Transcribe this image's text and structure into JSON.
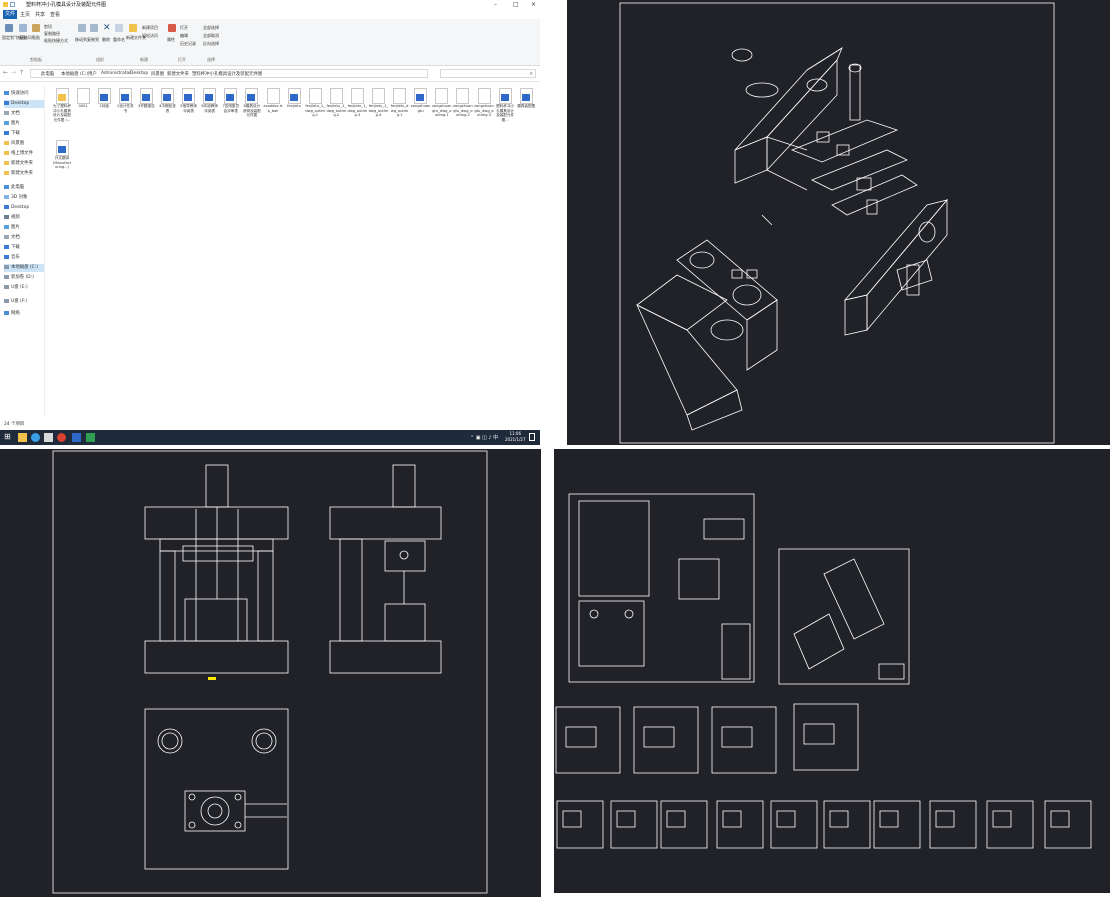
{
  "explorer": {
    "title": "塑料杯冲小孔模具设计及装配元件图",
    "tabs": [
      "文件",
      "主页",
      "共享",
      "查看"
    ],
    "active_tab": "文件",
    "ribbon": {
      "pin_label": "固定到\"快速访问\"",
      "copy_label": "复制",
      "paste_label": "粘贴",
      "copy_path": "复制路径",
      "paste_shortcut": "粘贴快捷方式",
      "cut": "剪切",
      "move_to": "移动到",
      "copy_to": "复制到",
      "delete": "删除",
      "rename": "重命名",
      "new_folder": "新建文件夹",
      "new_item": "新建项目",
      "easy_access": "轻松访问",
      "properties": "属性",
      "open": "打开",
      "edit": "编辑",
      "history": "历史记录",
      "select_all": "全部选择",
      "select_none": "全部取消",
      "invert": "反向选择",
      "groups": [
        "剪贴板",
        "组织",
        "新建",
        "打开",
        "选择"
      ]
    },
    "breadcrumb": [
      "此电脑",
      "本地磁盘 (C:)",
      "用户",
      "Administrator",
      "Desktop",
      "风景图",
      "新建文件夹",
      "塑料杯冲小孔模具设计及装配元件图"
    ],
    "nav": [
      {
        "label": "快速访问",
        "selected": false
      },
      {
        "label": "Desktop",
        "selected": true
      },
      {
        "label": "文档",
        "selected": false
      },
      {
        "label": "图片",
        "selected": false
      },
      {
        "label": "下载",
        "selected": false
      },
      {
        "label": "风景图",
        "selected": false
      },
      {
        "label": "线上博文件",
        "selected": false
      },
      {
        "label": "新建文件夹",
        "selected": false
      },
      {
        "label": "新建文件夹",
        "selected": false
      },
      {
        "label": "此电脑",
        "selected": false
      },
      {
        "label": "3D 对象",
        "selected": false
      },
      {
        "label": "Desktop",
        "selected": false
      },
      {
        "label": "视频",
        "selected": false
      },
      {
        "label": "图片",
        "selected": false
      },
      {
        "label": "文档",
        "selected": false
      },
      {
        "label": "下载",
        "selected": false
      },
      {
        "label": "音乐",
        "selected": false
      },
      {
        "label": "本地磁盘 (C:)",
        "selected": true
      },
      {
        "label": "新加卷 (D:)",
        "selected": false
      },
      {
        "label": "U盘 (E:)",
        "selected": false
      },
      {
        "label": "U盘 (F:)",
        "selected": false
      },
      {
        "label": "网络",
        "selected": false
      }
    ],
    "files": [
      {
        "label": "为了塑料杯冲小孔模具设计及装配元件图 (...",
        "icon": "zip"
      },
      {
        "label": "0001",
        "icon": "blank"
      },
      {
        "label": "1封面",
        "icon": "word"
      },
      {
        "label": "2设计任务书",
        "icon": "word"
      },
      {
        "label": "3开题报告",
        "icon": "word"
      },
      {
        "label": "4中期检查表",
        "icon": "word"
      },
      {
        "label": "5指导教师评阅表",
        "icon": "word"
      },
      {
        "label": "6评阅教师评阅表",
        "icon": "word"
      },
      {
        "label": "7答辩委员会评审表",
        "icon": "word"
      },
      {
        "label": "8模具设计说明及装配元件图",
        "icon": "word"
      },
      {
        "label": "acaddoc.lsp_bak",
        "icon": "blank"
      },
      {
        "label": "fenjietu",
        "icon": "dwg"
      },
      {
        "label": "fenjietu_1_dwg_outimg.1",
        "icon": "blank"
      },
      {
        "label": "fenjietu_1_dwg_outimg.2",
        "icon": "blank"
      },
      {
        "label": "fenjietu_1_dwg_outimg.3",
        "icon": "blank"
      },
      {
        "label": "fenjietu_1_dwg_outimg.4",
        "icon": "blank"
      },
      {
        "label": "fenjietu_dwg_outimg.1",
        "icon": "blank"
      },
      {
        "label": "zongzhuangtu",
        "icon": "dwg"
      },
      {
        "label": "zongzhuangtu_dwg_outimg.1",
        "icon": "blank"
      },
      {
        "label": "zongzhuangtu_dwg_outimg.2",
        "icon": "blank"
      },
      {
        "label": "zongzhuangtu_dwg_outimg.3",
        "icon": "blank"
      },
      {
        "label": "塑料杯冲小孔模具设计及装配元件图...",
        "icon": "word"
      },
      {
        "label": "模具装配图",
        "icon": "dwg"
      },
      {
        "label": "外文翻译 (Manufacturing...)",
        "icon": "word"
      }
    ],
    "status_count": "24 个项目",
    "clock_time": "11:06",
    "clock_date": "2021/1/27"
  },
  "colors": {
    "cad_background": "#212227",
    "cad_stroke": "#ffffff",
    "accent": "#1a64b4",
    "marker": "#ffe600"
  }
}
